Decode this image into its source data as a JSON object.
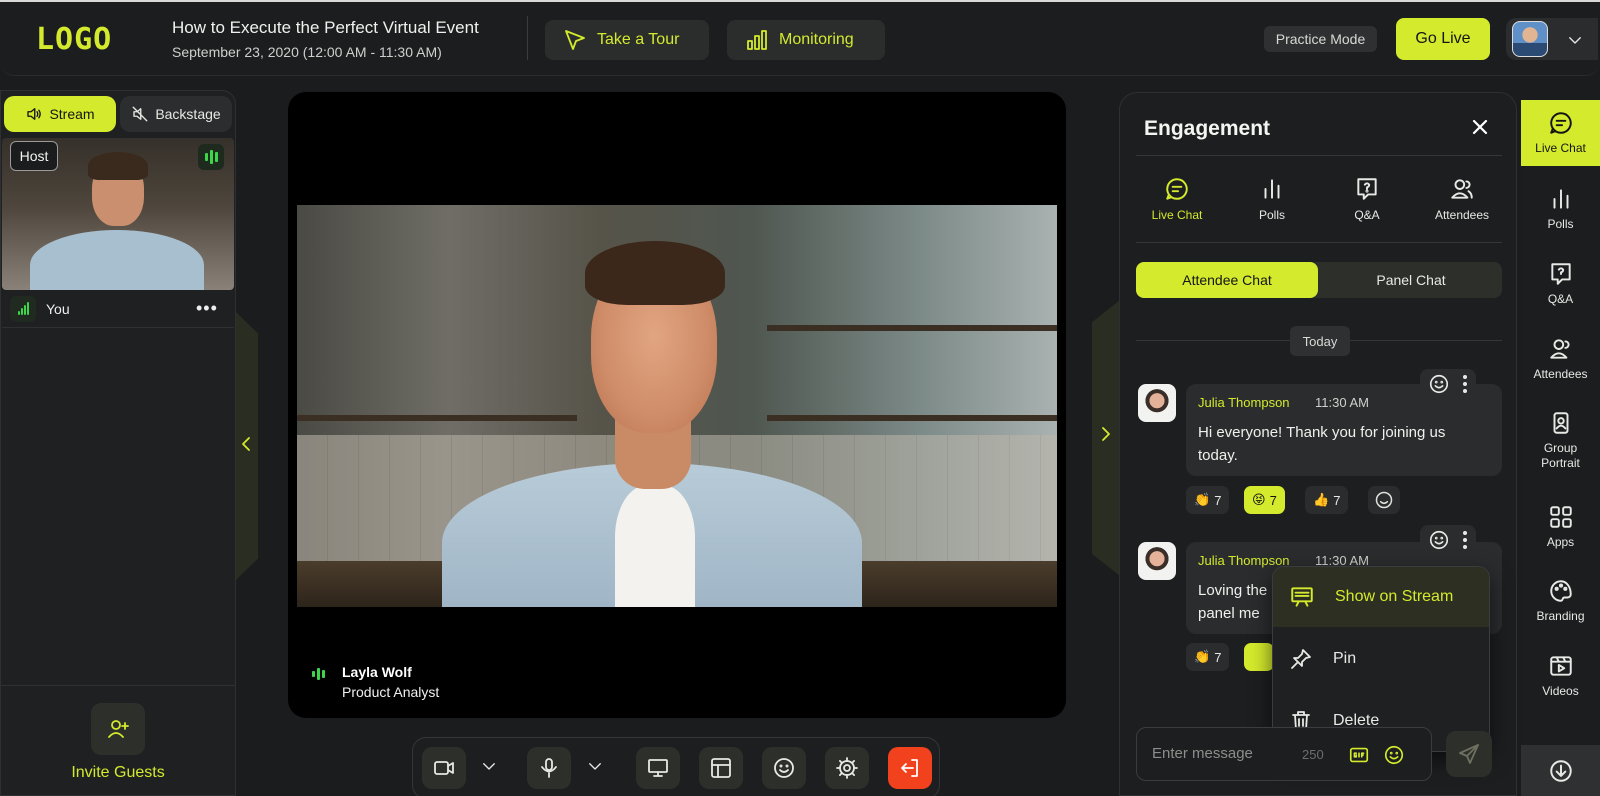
{
  "header": {
    "logo": "LOGO",
    "event_title": "How to Execute the Perfect Virtual Event",
    "event_date": "September 23, 2020 (12:00 AM - 11:30 AM)",
    "take_tour": "Take a Tour",
    "monitoring": "Monitoring",
    "practice_mode": "Practice Mode",
    "go_live": "Go Live"
  },
  "left_panel": {
    "stream_tab": "Stream",
    "backstage_tab": "Backstage",
    "host_badge": "Host",
    "you_label": "You",
    "more": "•••",
    "invite_guests": "Invite Guests"
  },
  "stage": {
    "speaker_name": "Layla Wolf",
    "speaker_role": "Product Analyst"
  },
  "engagement": {
    "title": "Engagement",
    "tabs": [
      {
        "label": "Live Chat",
        "icon": "chat-icon"
      },
      {
        "label": "Polls",
        "icon": "polls-icon"
      },
      {
        "label": "Q&A",
        "icon": "qa-icon"
      },
      {
        "label": "Attendees",
        "icon": "attendees-icon"
      }
    ],
    "attendee_chat": "Attendee Chat",
    "panel_chat": "Panel Chat",
    "today": "Today",
    "messages": [
      {
        "author": "Julia Thompson",
        "time": "11:30 AM",
        "text": "Hi everyone! Thank you for joining us today.",
        "reactions": [
          {
            "emoji": "👏",
            "count": "7"
          },
          {
            "emoji": "😝",
            "count": "7"
          },
          {
            "emoji": "👍",
            "count": "7"
          }
        ]
      },
      {
        "author": "Julia Thompson",
        "time": "11:30 AM",
        "text_line1": "Loving the",
        "text_line2": "panel me",
        "reactions": [
          {
            "emoji": "👏",
            "count": "7"
          }
        ]
      }
    ],
    "context_menu": {
      "show_on_stream": "Show on Stream",
      "pin": "Pin",
      "delete": "Delete"
    },
    "input_placeholder": "Enter message",
    "char_count": "250"
  },
  "rail": [
    {
      "label": "Live Chat",
      "icon": "chat-icon"
    },
    {
      "label": "Polls",
      "icon": "polls-icon"
    },
    {
      "label": "Q&A",
      "icon": "qa-icon"
    },
    {
      "label": "Attendees",
      "icon": "attendees-icon"
    },
    {
      "label": "Group Portrait",
      "icon": "portrait-icon"
    },
    {
      "label": "Apps",
      "icon": "apps-icon"
    },
    {
      "label": "Branding",
      "icon": "palette-icon"
    },
    {
      "label": "Videos",
      "icon": "videos-icon"
    }
  ],
  "colors": {
    "accent": "#d4ea2c",
    "background": "#1a1c1e",
    "leave": "#f2411d",
    "audio_green": "#3dd64a"
  }
}
